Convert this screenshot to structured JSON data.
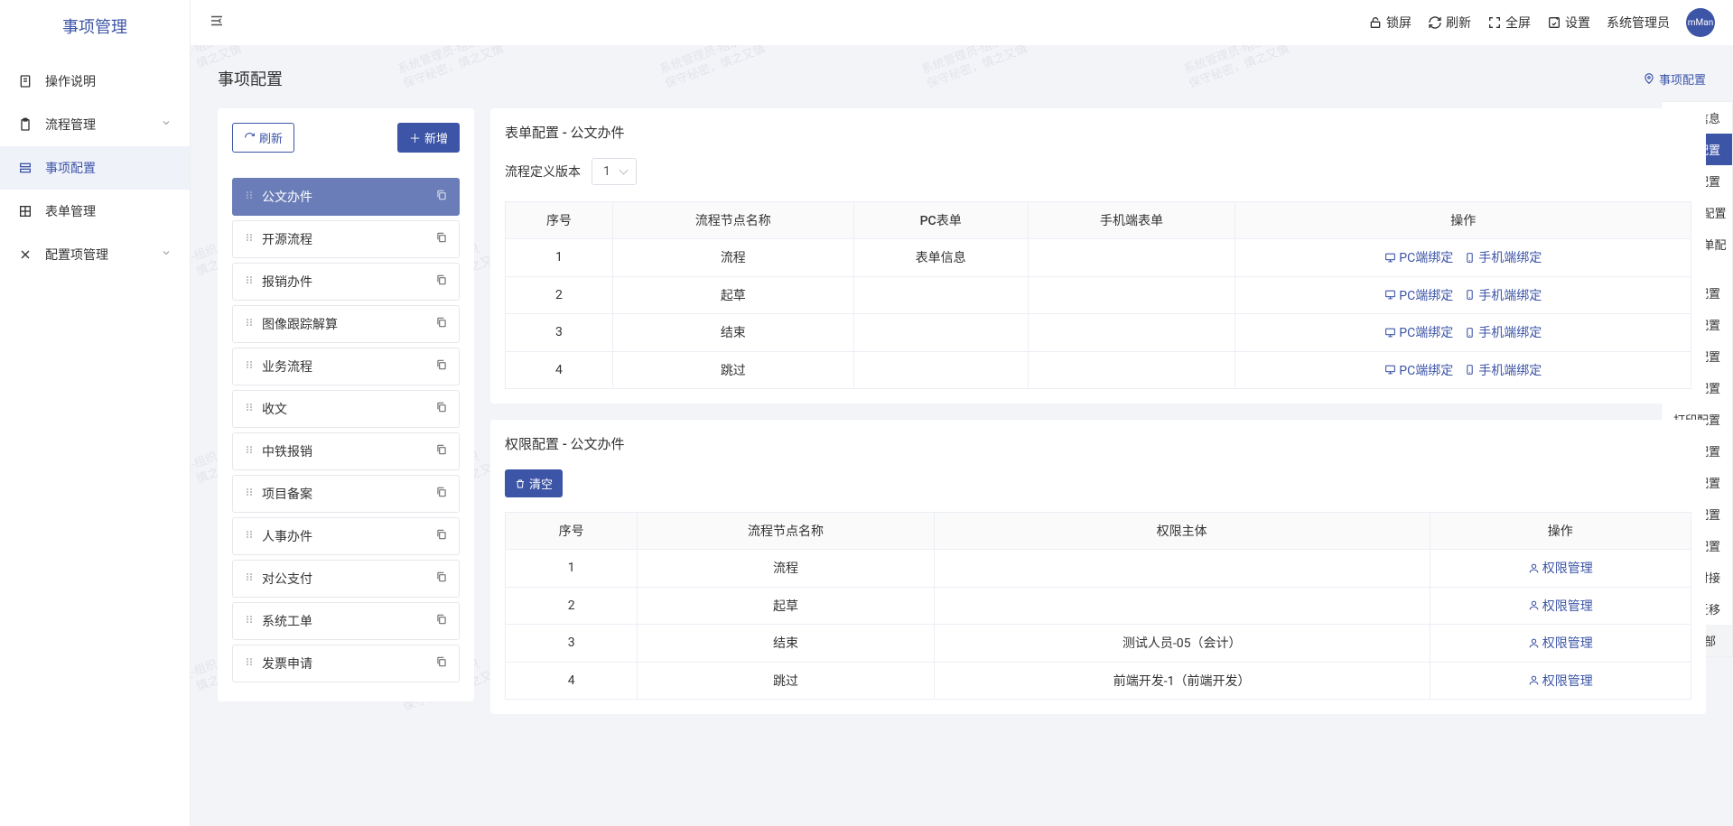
{
  "app_title": "事项管理",
  "topbar": {
    "lock": "锁屏",
    "refresh": "刷新",
    "fullscreen": "全屏",
    "settings": "设置",
    "user": "系统管理员",
    "avatar": "mMan"
  },
  "sidebar": {
    "items": [
      {
        "label": "操作说明",
        "icon": "doc"
      },
      {
        "label": "流程管理",
        "icon": "clipboard",
        "expand": true
      },
      {
        "label": "事项配置",
        "icon": "layers",
        "active": true
      },
      {
        "label": "表单管理",
        "icon": "grid"
      },
      {
        "label": "配置项管理",
        "icon": "tool",
        "expand": true
      }
    ]
  },
  "page": {
    "title": "事项配置"
  },
  "breadcrumb": {
    "label": "事项配置"
  },
  "left": {
    "refresh": "刷新",
    "add": "新增",
    "items": [
      {
        "label": "公文办件",
        "active": true
      },
      {
        "label": "开源流程"
      },
      {
        "label": "报销办件"
      },
      {
        "label": "图像跟踪解算"
      },
      {
        "label": "业务流程"
      },
      {
        "label": "收文"
      },
      {
        "label": "中铁报销"
      },
      {
        "label": "项目备案"
      },
      {
        "label": "人事办件"
      },
      {
        "label": "对公支付"
      },
      {
        "label": "系统工单"
      },
      {
        "label": "发票申请"
      }
    ]
  },
  "form_section": {
    "title": "表单配置 - 公文办件",
    "version_label": "流程定义版本",
    "version_value": "1",
    "cols": [
      "序号",
      "流程节点名称",
      "PC表单",
      "手机端表单",
      "操作"
    ],
    "pc_bind": "PC端绑定",
    "mobile_bind": "手机端绑定",
    "rows": [
      {
        "no": "1",
        "name": "流程",
        "pc": "表单信息",
        "mobile": ""
      },
      {
        "no": "2",
        "name": "起草",
        "pc": "",
        "mobile": ""
      },
      {
        "no": "3",
        "name": "结束",
        "pc": "",
        "mobile": ""
      },
      {
        "no": "4",
        "name": "跳过",
        "pc": "",
        "mobile": ""
      }
    ]
  },
  "perm_section": {
    "title": "权限配置 - 公文办件",
    "clear": "清空",
    "cols": [
      "序号",
      "流程节点名称",
      "权限主体",
      "操作"
    ],
    "manage": "权限管理",
    "rows": [
      {
        "no": "1",
        "name": "流程",
        "subject": ""
      },
      {
        "no": "2",
        "name": "起草",
        "subject": ""
      },
      {
        "no": "3",
        "name": "结束",
        "subject": "测试人员-05（会计）"
      },
      {
        "no": "4",
        "name": "跳过",
        "subject": "前端开发-1（前端开发）"
      }
    ]
  },
  "anchor": {
    "items": [
      "事项信息",
      "表单配置",
      "权限配置",
      "意见框配置",
      "前置表单配置",
      "编号配置",
      "链接配置",
      "接口配置",
      "正文配置",
      "打印配置",
      "签收配置",
      "路由配置",
      "按钮配置",
      "视图配置",
      "系统对接",
      "数据迁移"
    ],
    "active": 1,
    "top": "顶部"
  },
  "watermark": {
    "line1": "系统管理员-组织",
    "line2": "保守秘密，慎之又慎"
  }
}
